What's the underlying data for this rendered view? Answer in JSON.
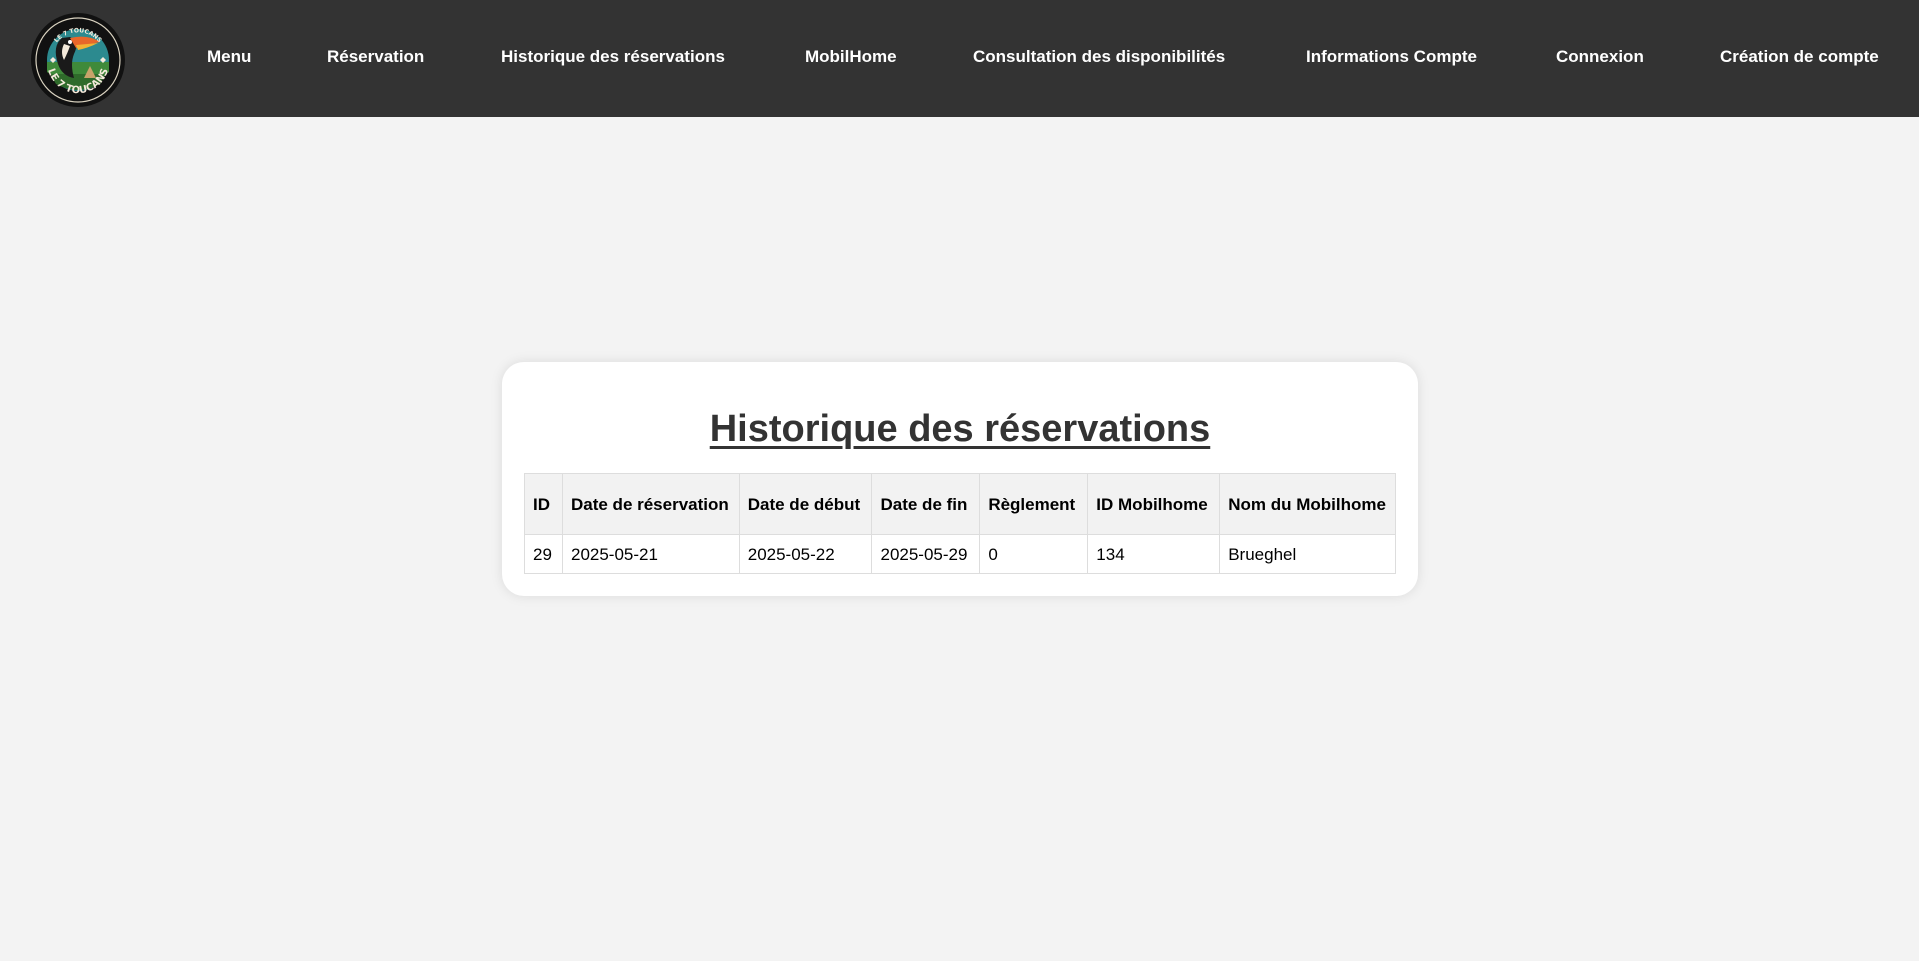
{
  "nav": {
    "logo_alt": "Le 7 Toucans",
    "items": [
      {
        "label": "Menu"
      },
      {
        "label": "Réservation"
      },
      {
        "label": "Historique des réservations"
      },
      {
        "label": "MobilHome"
      },
      {
        "label": "Consultation des disponibilités"
      },
      {
        "label": "Informations Compte"
      },
      {
        "label": "Connexion"
      },
      {
        "label": "Création de compte"
      }
    ]
  },
  "main": {
    "title": "Historique des réservations",
    "table": {
      "headers": [
        "ID",
        "Date de réservation",
        "Date de début",
        "Date de fin",
        "Règlement",
        "ID Mobilhome",
        "Nom du Mobilhome"
      ],
      "rows": [
        [
          "29",
          "2025-05-21",
          "2025-05-22",
          "2025-05-29",
          "0",
          "134",
          "Brueghel"
        ]
      ]
    }
  },
  "colors": {
    "navbar_bg": "#333333",
    "page_bg": "#f3f3f3",
    "card_bg": "#ffffff",
    "header_bg": "#f2f2f2",
    "toucan_orange": "#e8672a"
  },
  "icons": {
    "logo": "toucan-logo-icon"
  }
}
